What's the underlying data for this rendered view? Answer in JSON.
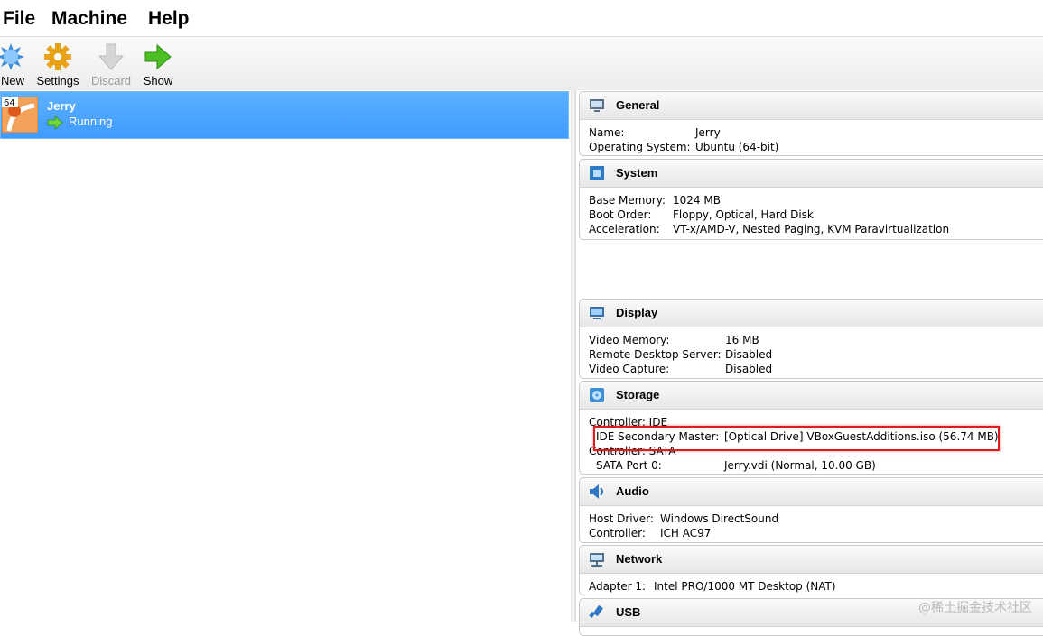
{
  "menu": {
    "items": [
      "File",
      "Machine",
      "Help"
    ]
  },
  "toolbar": {
    "new_label": "New",
    "settings_label": "Settings",
    "discard_label": "Discard",
    "show_label": "Show"
  },
  "vm": {
    "os_badge": "64",
    "name": "Jerry",
    "state": "Running",
    "selected_color": "#3f9bff"
  },
  "sections": {
    "general": {
      "title": "General",
      "rows": [
        {
          "key": "Name:",
          "value": "Jerry"
        },
        {
          "key": "Operating System:",
          "value": "Ubuntu (64-bit)"
        }
      ]
    },
    "system": {
      "title": "System",
      "rows": [
        {
          "key": "Base Memory:",
          "value": "1024 MB"
        },
        {
          "key": "Boot Order:",
          "value": "Floppy, Optical, Hard Disk"
        },
        {
          "key": "Acceleration:",
          "value": "VT-x/AMD-V, Nested Paging, KVM Paravirtualization"
        }
      ]
    },
    "display": {
      "title": "Display",
      "rows": [
        {
          "key": "Video Memory:",
          "value": "16 MB"
        },
        {
          "key": "Remote Desktop Server:",
          "value": "Disabled"
        },
        {
          "key": "Video Capture:",
          "value": "Disabled"
        }
      ]
    },
    "storage": {
      "title": "Storage",
      "rows": [
        {
          "key": "Controller: IDE",
          "value": ""
        },
        {
          "key": "IDE Secondary Master:",
          "value": "[Optical Drive] VBoxGuestAdditions.iso (56.74 MB)"
        },
        {
          "key": "Controller: SATA",
          "value": ""
        },
        {
          "key": "SATA Port 0:",
          "value": "Jerry.vdi (Normal, 10.00 GB)"
        }
      ]
    },
    "audio": {
      "title": "Audio",
      "rows": [
        {
          "key": "Host Driver:",
          "value": "Windows DirectSound"
        },
        {
          "key": "Controller:",
          "value": "ICH AC97"
        }
      ]
    },
    "network": {
      "title": "Network",
      "rows": [
        {
          "key": "Adapter 1:",
          "value": "Intel PRO/1000 MT Desktop (NAT)"
        }
      ]
    },
    "usb": {
      "title": "USB"
    }
  },
  "watermark": "@稀土掘金技术社区",
  "icons": {
    "new": "new-starburst-icon",
    "settings": "gear-icon",
    "discard": "arrow-down-icon",
    "show": "arrow-right-icon",
    "running": "arrow-right-icon",
    "general": "monitor-icon",
    "system": "chip-icon",
    "display": "display-icon",
    "storage": "disk-icon",
    "audio": "speaker-icon",
    "network": "network-icon",
    "usb": "usb-icon"
  },
  "colors": {
    "highlight_box": "#d81e1e"
  }
}
